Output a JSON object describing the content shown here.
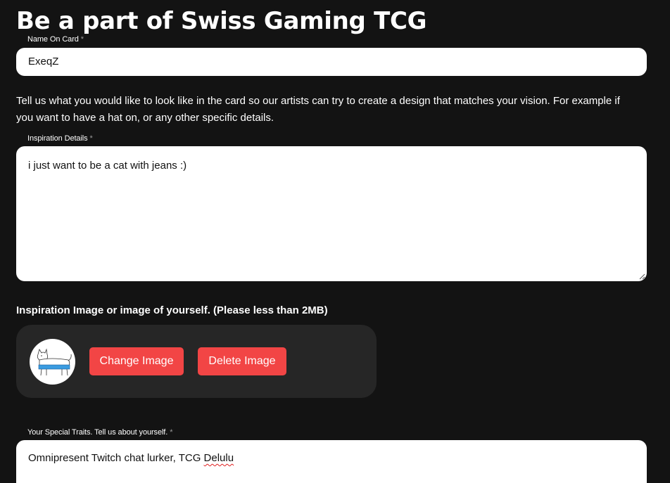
{
  "page": {
    "title": "Be a part of Swiss Gaming TCG"
  },
  "name_field": {
    "label": "Name On Card",
    "required_mark": "*",
    "value": "ExeqZ"
  },
  "help_text": "Tell us what you would like to look like in the card so our artists can try to create a design that matches your vision. For example if you want to have a hat on, or any other specific details.",
  "inspiration_field": {
    "label": "Inspiration Details",
    "required_mark": "*",
    "value": "i just want to be a cat with jeans :)"
  },
  "image_section": {
    "heading": "Inspiration Image or image of yourself. (Please less than 2MB)",
    "preview_icon": "cat-with-jeans-drawing",
    "change_button": "Change Image",
    "delete_button": "Delete Image",
    "button_color": "#f24545"
  },
  "traits_field": {
    "label": "Your Special Traits. Tell us about yourself.",
    "required_mark": "*",
    "value_prefix": "Omnipresent Twitch chat lurker, TCG ",
    "value_misspelled": "Delulu"
  },
  "colors": {
    "background": "#131313",
    "panel": "#262626",
    "input_background": "#ffffff"
  }
}
